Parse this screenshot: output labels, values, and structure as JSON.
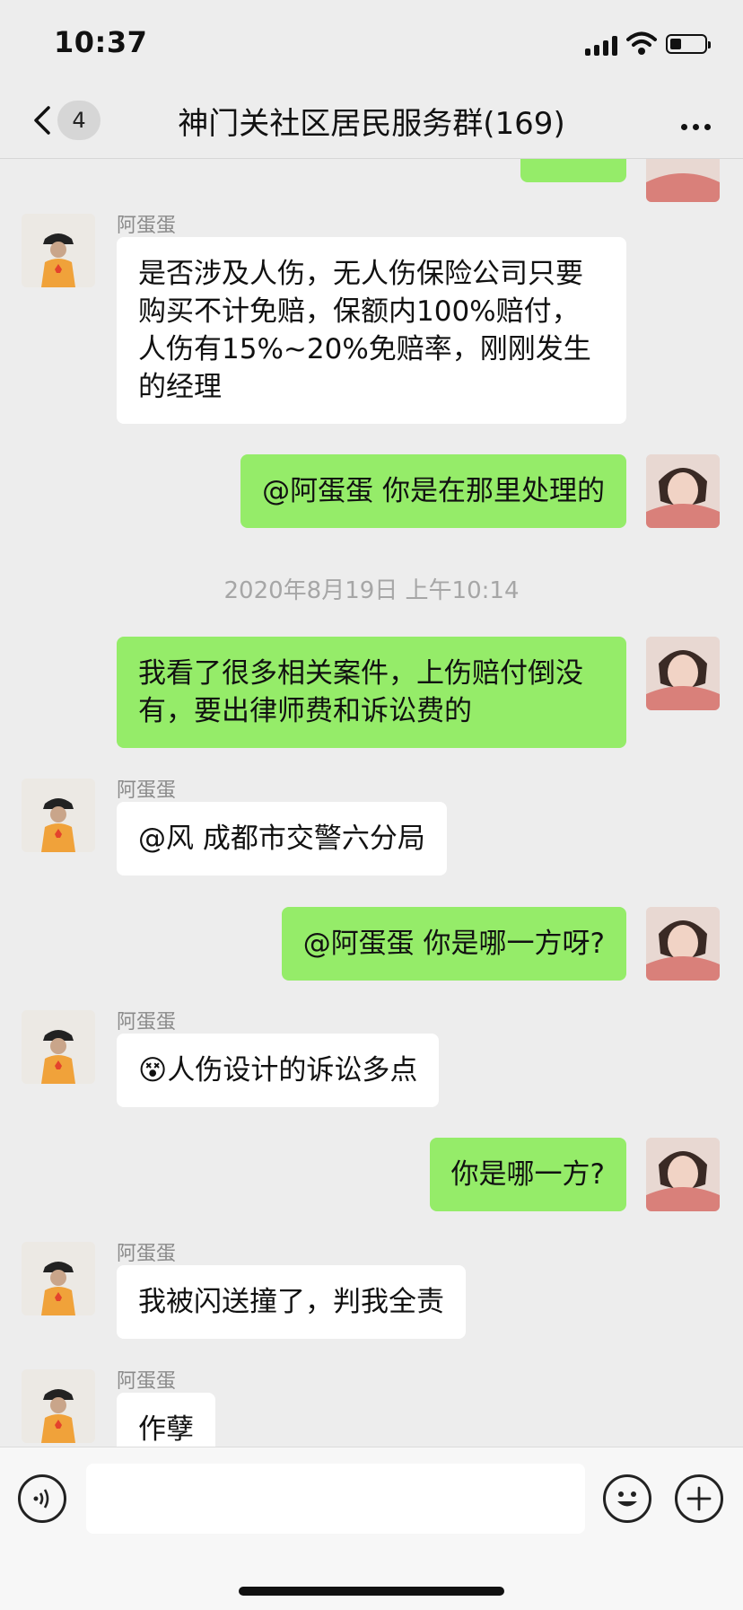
{
  "status": {
    "time": "10:37"
  },
  "header": {
    "back_count": "4",
    "title": "神门关社区居民服务群(169)"
  },
  "timestamp": "2020年8月19日 上午10:14",
  "messages": [
    {
      "sender": "阿蛋蛋",
      "text": "是否涉及人伤，无人伤保险公司只要购买不计免赔，保额内100%赔付，人伤有15%~20%免赔率，刚刚发生的经理"
    },
    {
      "text": "@阿蛋蛋 你是在那里处理的"
    },
    {
      "text": "我看了很多相关案件，上伤赔付倒没有，要出律师费和诉讼费的"
    },
    {
      "sender": "阿蛋蛋",
      "text": "@风 成都市交警六分局"
    },
    {
      "text": "@阿蛋蛋 你是哪一方呀?"
    },
    {
      "sender": "阿蛋蛋",
      "emoji": "😵",
      "text": "人伤设计的诉讼多点"
    },
    {
      "text": "你是哪一方?"
    },
    {
      "sender": "阿蛋蛋",
      "text": "我被闪送撞了，判我全责"
    },
    {
      "sender": "阿蛋蛋",
      "text": "作孽"
    }
  ],
  "icons": {
    "back": "chevron-left-icon",
    "more": "more-dots-icon",
    "voice": "voice-icon",
    "emoji": "emoji-icon",
    "plus": "plus-icon"
  },
  "colors": {
    "outgoing_bubble": "#95ec69",
    "incoming_bubble": "#ffffff",
    "background": "#ededed"
  }
}
